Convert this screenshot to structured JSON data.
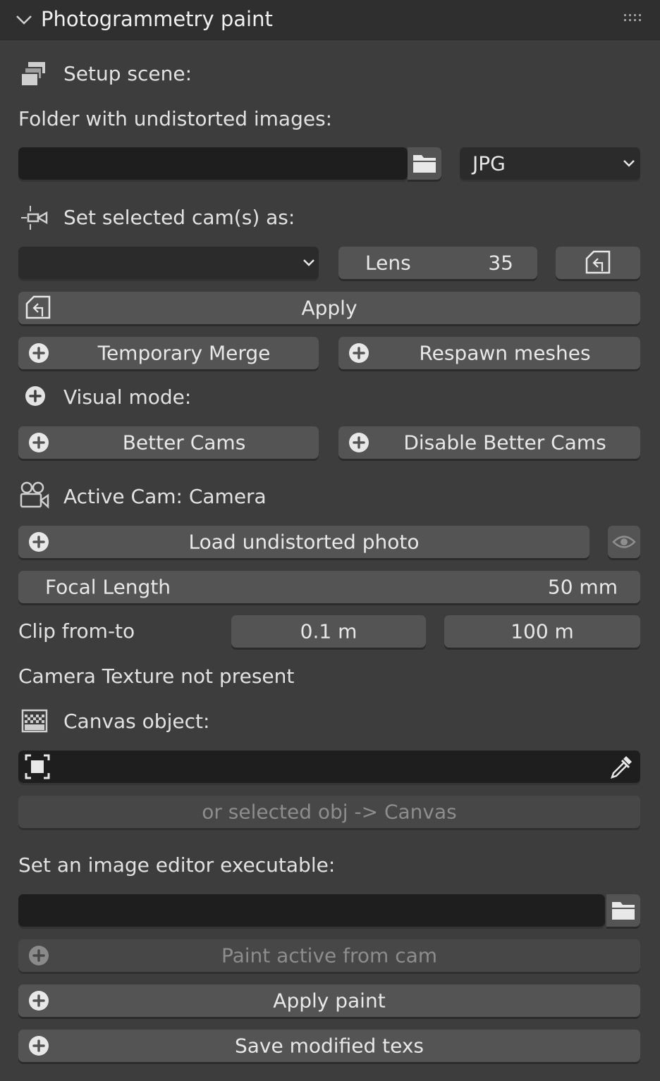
{
  "panel": {
    "title": "Photogrammetry paint"
  },
  "setup": {
    "heading": "Setup scene:",
    "folder_label": "Folder with undistorted images:",
    "folder_value": "",
    "format": "JPG"
  },
  "cams": {
    "heading": "Set selected cam(s) as:",
    "dropdown_value": "",
    "lens_label": "Lens",
    "lens_value": "35",
    "apply_label": "Apply",
    "temporary_merge": "Temporary Merge",
    "respawn_meshes": "Respawn meshes"
  },
  "visual": {
    "heading": "Visual mode:",
    "better_cams": "Better Cams",
    "disable_better_cams": "Disable Better Cams"
  },
  "active_cam": {
    "heading": "Active Cam: Camera",
    "load_photo": "Load undistorted photo",
    "focal_label": "Focal Length",
    "focal_value": "50 mm",
    "clip_label": "Clip from-to",
    "clip_start": "0.1 m",
    "clip_end": "100 m",
    "texture_status": "Camera Texture not present"
  },
  "canvas": {
    "heading": "Canvas object:",
    "object_value": "",
    "selected_to_canvas": "or selected obj -> Canvas"
  },
  "editor": {
    "heading": "Set an image editor executable:",
    "path_value": "",
    "paint_active": "Paint active from cam",
    "apply_paint": "Apply paint",
    "save_texs": "Save modified texs"
  },
  "colors": {
    "background": "#3d3d3d",
    "button": "#545454",
    "field": "#1e1e1e",
    "text": "#e6e6e6",
    "disabled_text": "#8d8d8d"
  }
}
